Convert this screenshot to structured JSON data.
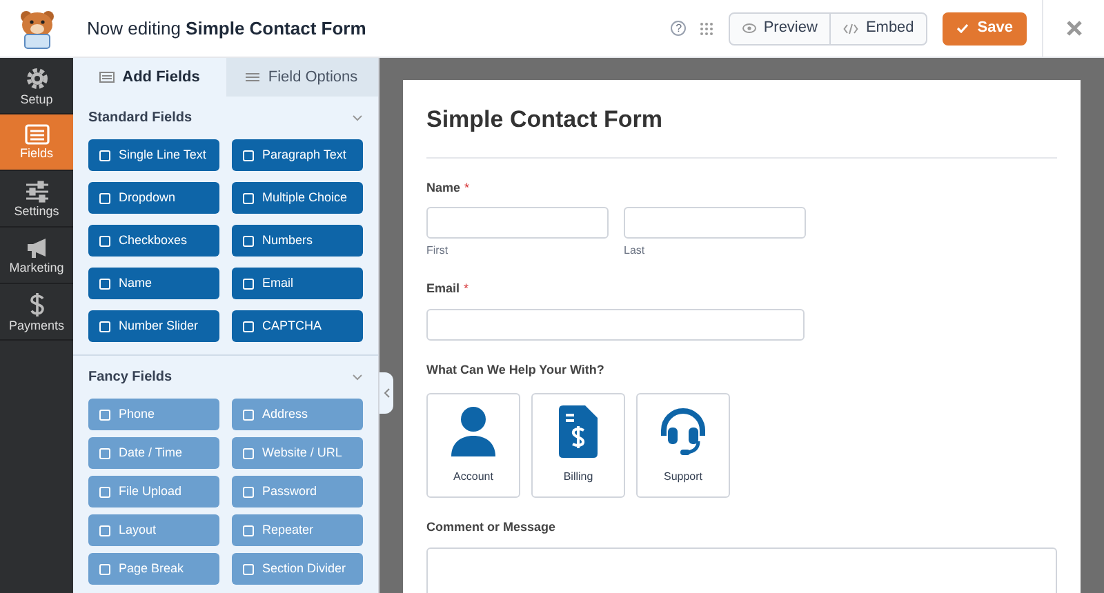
{
  "header": {
    "prefix": "Now editing",
    "title": "Simple Contact Form",
    "help": "?",
    "preview": "Preview",
    "embed": "Embed",
    "save": "Save"
  },
  "sidebar": [
    {
      "label": "Setup",
      "selected": false
    },
    {
      "label": "Fields",
      "selected": true
    },
    {
      "label": "Settings",
      "selected": false
    },
    {
      "label": "Marketing",
      "selected": false
    },
    {
      "label": "Payments",
      "selected": false
    }
  ],
  "tabs": [
    {
      "label": "Add Fields",
      "selected": true
    },
    {
      "label": "Field Options",
      "selected": false
    }
  ],
  "sections": [
    {
      "title": "Standard Fields",
      "kind": "standard",
      "fields": [
        "Single Line Text",
        "Paragraph Text",
        "Dropdown",
        "Multiple Choice",
        "Checkboxes",
        "Numbers",
        "Name",
        "Email",
        "Number Slider",
        "CAPTCHA"
      ]
    },
    {
      "title": "Fancy Fields",
      "kind": "fancy",
      "fields": [
        "Phone",
        "Address",
        "Date / Time",
        "Website / URL",
        "File Upload",
        "Password",
        "Layout",
        "Repeater",
        "Page Break",
        "Section Divider"
      ]
    }
  ],
  "form": {
    "title": "Simple Contact Form",
    "fields": [
      {
        "kind": "name",
        "label": "Name",
        "required_mark": "*",
        "sublabels": [
          "First",
          "Last"
        ]
      },
      {
        "kind": "email",
        "label": "Email",
        "required_mark": "*"
      },
      {
        "kind": "choices",
        "label": "What Can We Help Your With?",
        "options": [
          "Account",
          "Billing",
          "Support"
        ]
      },
      {
        "kind": "textarea",
        "label": "Comment or Message"
      }
    ]
  }
}
